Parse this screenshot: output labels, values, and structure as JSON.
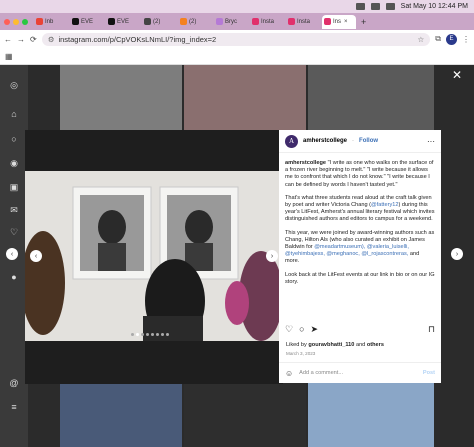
{
  "system_bar": {
    "datetime": "Sat May 10  12:44 PM"
  },
  "tabs": [
    {
      "label": "Inb",
      "color": "#ea4335"
    },
    {
      "label": "EVE",
      "color": "#111111"
    },
    {
      "label": "EVE",
      "color": "#111111"
    },
    {
      "label": "(2)",
      "color": "#444444"
    },
    {
      "label": "(2)",
      "color": "#f48120"
    },
    {
      "label": "Bryc",
      "color": "#b57ad6"
    },
    {
      "label": "Insta",
      "color": "#e1306c"
    },
    {
      "label": "Insta",
      "color": "#e1306c"
    },
    {
      "label": "Ins",
      "color": "#e1306c",
      "active": true
    }
  ],
  "address_bar": {
    "url": "instagram.com/p/CpVOKsLNmLI/?img_index=2",
    "profile_initial": "E"
  },
  "post": {
    "username": "amherstcollege",
    "follow_label": "Follow",
    "avatar_letter": "A",
    "caption_lead": "amherstcollege",
    "caption_p1": "\"I write as one who walks on the surface of a frozen river beginning to melt.\" \"I write because it allows me to confront that which I do not know.\" \"I write because I can be defined by words I haven't tasted yet.\"",
    "caption_p2_a": "That's what three students read aloud at the craft talk given by poet and writer Victoria Chang (",
    "caption_p2_link": "@fattery12",
    "caption_p2_b": ") during this year's LitFest, Amherst's annual literary festival which invites distinguished authors and editors to campus for a weekend.",
    "caption_p3_a": "This year, we were joined by award-winning authors such as Chang, Hilton Als (who also curated an exhibit on James Baldwin for ",
    "caption_p3_links": "@meadartmuseum), @valeria_luiselli, @tyehimbajess, @meghanoc, @l_rojascontreras,",
    "caption_p3_b": " and more.",
    "caption_p4": "Look back at the LitFest events at our link in bio or on our IG story.",
    "likes_prefix": "Liked by ",
    "likes_user": "gouravbhatti_110",
    "likes_suffix": " and ",
    "likes_others": "others",
    "date": "March 3, 2023",
    "comment_placeholder": "Add a comment...",
    "post_label": "Post"
  },
  "icons": {
    "close": "close-icon",
    "prev": "chevron-left-icon",
    "next": "chevron-right-icon"
  }
}
